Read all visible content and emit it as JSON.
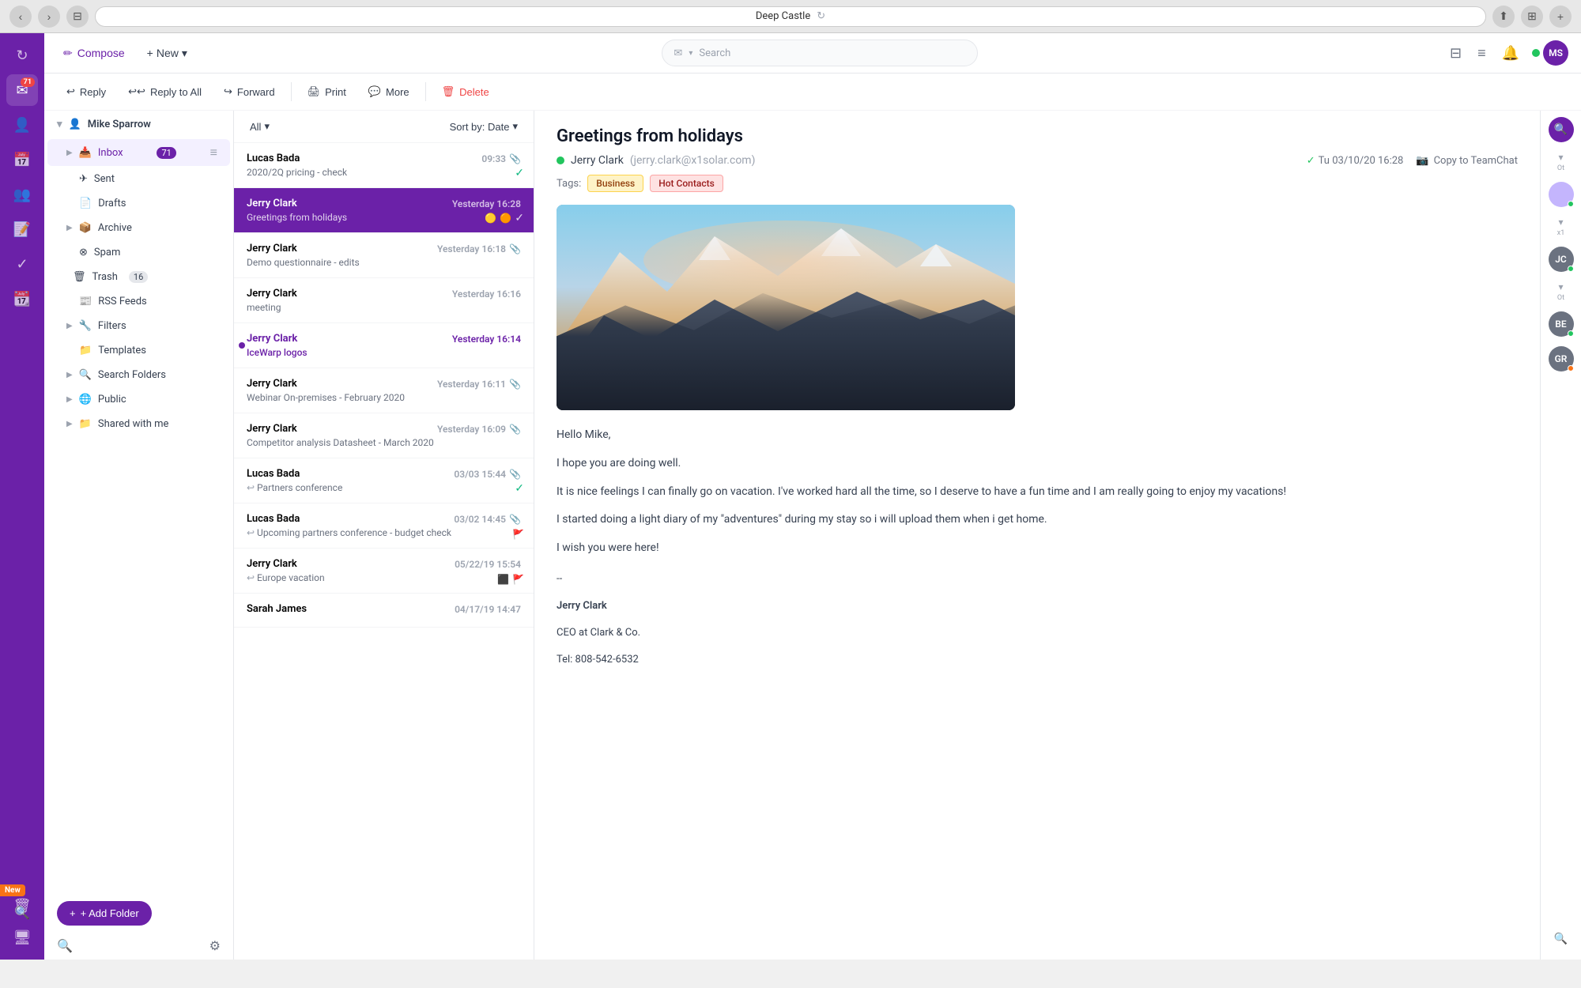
{
  "browser": {
    "tab_title": "Deep Castle",
    "back_label": "←",
    "forward_label": "→",
    "refresh_label": "↻"
  },
  "toolbar": {
    "compose_label": "Compose",
    "new_label": "New",
    "search_placeholder": "Search",
    "reply_label": "Reply",
    "reply_all_label": "Reply to All",
    "forward_label": "Forward",
    "print_label": "Print",
    "more_label": "More",
    "delete_label": "Delete"
  },
  "sidebar": {
    "account_name": "Mike Sparrow",
    "items": [
      {
        "label": "Inbox",
        "count": "71",
        "icon": "📥",
        "active": true
      },
      {
        "label": "Sent",
        "icon": "✉️"
      },
      {
        "label": "Drafts",
        "icon": "📄"
      },
      {
        "label": "Archive",
        "icon": "📦"
      },
      {
        "label": "Spam",
        "icon": "🚫"
      },
      {
        "label": "Trash",
        "count": "16",
        "icon": "🗑️"
      },
      {
        "label": "RSS Feeds",
        "icon": "📰"
      },
      {
        "label": "Filters",
        "icon": "🔧"
      },
      {
        "label": "Templates",
        "icon": "📁"
      },
      {
        "label": "Search Folders",
        "icon": "🔍"
      },
      {
        "label": "Public",
        "icon": "🌐"
      },
      {
        "label": "Shared with me",
        "icon": "📁"
      }
    ],
    "add_folder_label": "+ Add Folder"
  },
  "email_list": {
    "filter_label": "All",
    "sort_label": "Sort by: Date",
    "emails": [
      {
        "sender": "Lucas Bada",
        "time": "09:33",
        "subject": "2020/2Q pricing - check",
        "has_clip": true,
        "has_check": true
      },
      {
        "sender": "Jerry Clark",
        "time": "Yesterday 16:28",
        "subject": "Greetings from holidays",
        "selected": true,
        "has_stars": true,
        "has_check": true
      },
      {
        "sender": "Jerry Clark",
        "time": "Yesterday 16:18",
        "subject": "Demo questionnaire - edits",
        "has_clip": true
      },
      {
        "sender": "Jerry Clark",
        "time": "Yesterday 16:16",
        "subject": "meeting"
      },
      {
        "sender": "Jerry Clark",
        "time": "Yesterday 16:14",
        "subject": "IceWarp logos",
        "unread": true
      },
      {
        "sender": "Jerry Clark",
        "time": "Yesterday 16:11",
        "subject": "Webinar On-premises - February 2020",
        "has_clip": true
      },
      {
        "sender": "Jerry Clark",
        "time": "Yesterday 16:09",
        "subject": "Competitor analysis Datasheet - March 2020",
        "has_clip": true
      },
      {
        "sender": "Lucas Bada",
        "time": "03/03 15:44",
        "subject": "Partners conference",
        "is_reply": true,
        "has_check": true,
        "has_clip": true
      },
      {
        "sender": "Lucas Bada",
        "time": "03/02 14:45",
        "subject": "Upcoming partners conference - budget check",
        "is_reply": true,
        "has_flag": true,
        "has_clip": true
      },
      {
        "sender": "Jerry Clark",
        "time": "05/22/19 15:54",
        "subject": "Europe vacation",
        "is_reply": true,
        "has_star_yellow": true,
        "has_flag": true
      },
      {
        "sender": "Sarah James",
        "time": "04/17/19 14:47",
        "subject": ""
      }
    ]
  },
  "email_detail": {
    "subject": "Greetings from holidays",
    "from_name": "Jerry Clark",
    "from_email": "jerry.clark@x1solar.com",
    "date": "Tu 03/10/20 16:28",
    "copy_team_label": "Copy to TeamChat",
    "tags_label": "Tags:",
    "tag_business": "Business",
    "tag_hot": "Hot Contacts",
    "body_lines": [
      "Hello Mike,",
      "",
      "I hope you are doing well.",
      "",
      "It is nice feelings I can finally go on vacation. I've worked hard all the time, so I deserve to have a fun time and I am really going to enjoy my vacations!",
      "",
      "I started doing a light diary of my \"adventures\" during my stay so i will upload them when i get home.",
      "",
      "I wish you were here!",
      "",
      "--",
      "Jerry Clark",
      "CEO at Clark & Co.",
      "Tel: 808-542-6532"
    ]
  },
  "right_panel": {
    "avatars": [
      {
        "initials": "Ot",
        "color": "#9ca3af",
        "online": false
      },
      {
        "initials": "",
        "color": "#d1d5db",
        "online": true
      },
      {
        "initials": "x1",
        "label": "x1",
        "online": true,
        "is_label": true
      },
      {
        "initials": "JC",
        "color": "#6b7280",
        "online": true
      },
      {
        "initials": "Ot",
        "color": "#9ca3af",
        "online": false
      },
      {
        "initials": "BE",
        "color": "#6b7280",
        "online": true
      },
      {
        "initials": "GR",
        "color": "#6b7280",
        "online": true,
        "orange": true
      }
    ]
  }
}
